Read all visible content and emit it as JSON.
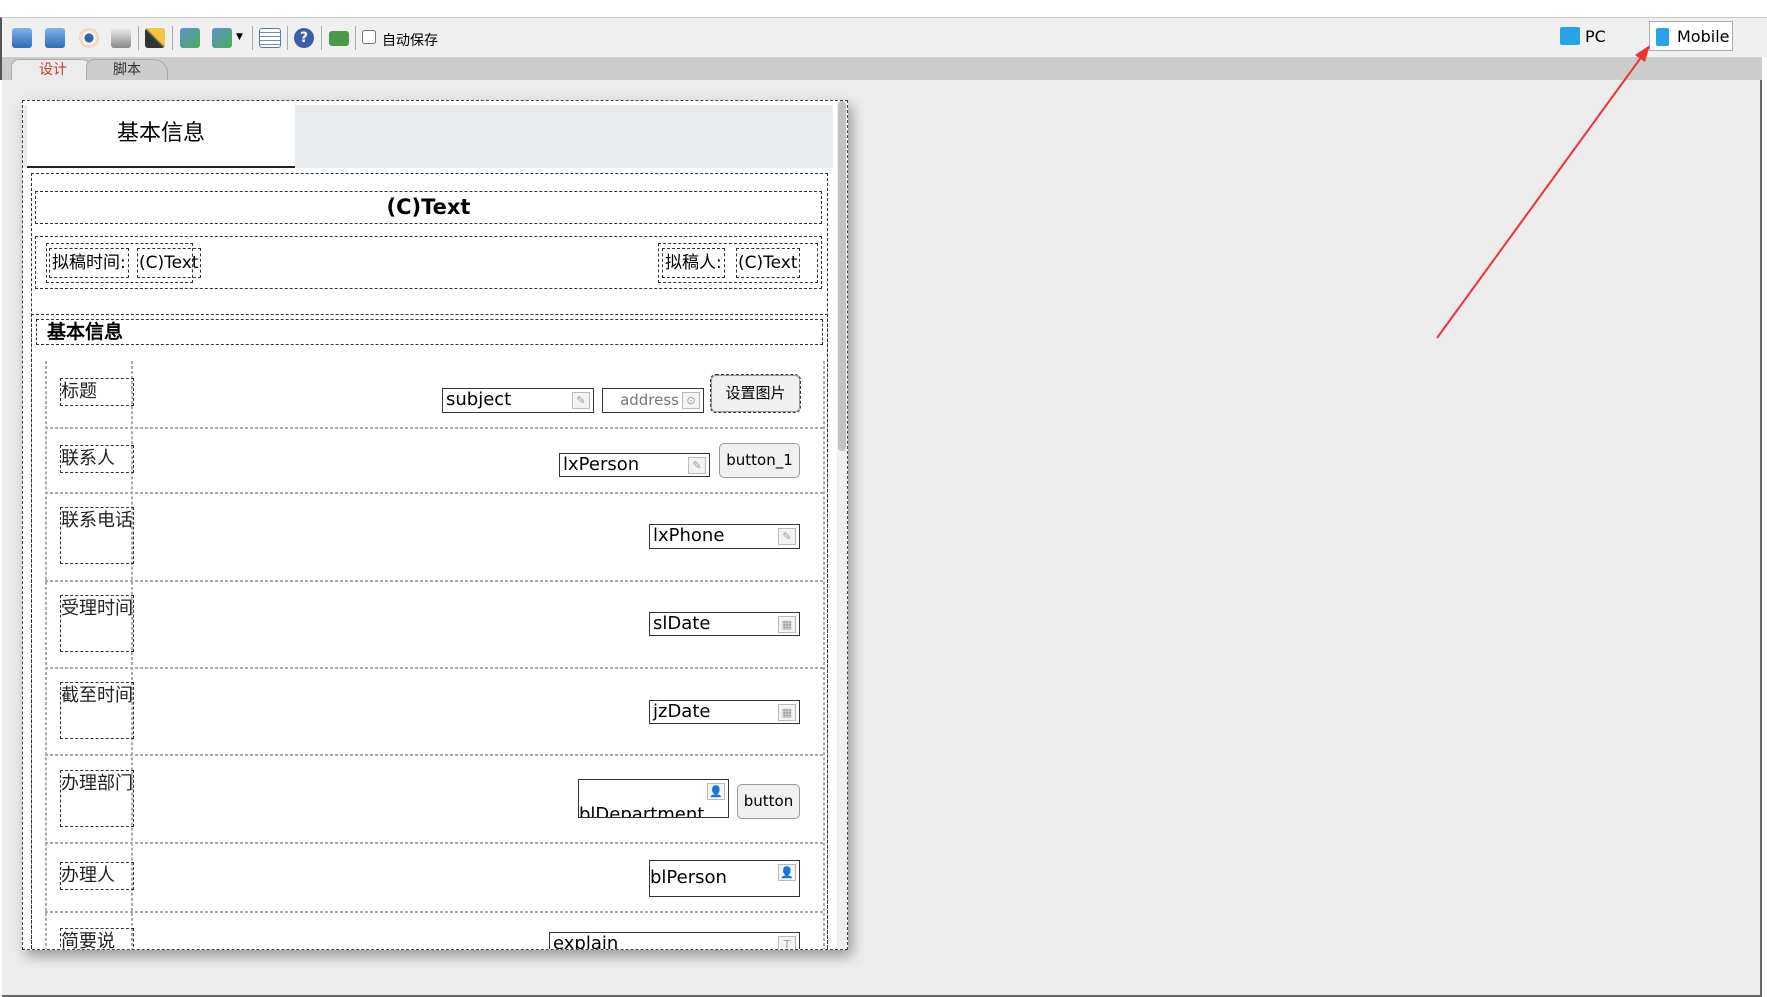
{
  "toolbar": {
    "icons": [
      "save-icon",
      "save-as-icon",
      "preview-icon",
      "print-icon",
      "wand-icon",
      "import-icon",
      "export-icon",
      "list-icon",
      "help-icon",
      "layers-icon"
    ],
    "autosave_label": "自动保存",
    "autosave_checked": false,
    "pc_label": "PC",
    "mobile_label": "Mobile"
  },
  "editor_tabs": [
    {
      "label": "设计",
      "active": true
    },
    {
      "label": "脚本",
      "active": false
    }
  ],
  "form": {
    "tab_label": "基本信息",
    "title_text": "(C)Text",
    "draft_time_label": "拟稿时间:",
    "draft_time_value": "(C)Text",
    "drafter_label": "拟稿人:",
    "drafter_value": "(C)Text",
    "section_title": "基本信息",
    "rows": [
      {
        "label": "标题",
        "field": "subject",
        "field2": "address",
        "button": "设置图片"
      },
      {
        "label": "联系人",
        "field": "lxPerson",
        "button": "button_1"
      },
      {
        "label": "联系电话",
        "field": "lxPhone"
      },
      {
        "label": "受理时间",
        "field": "slDate"
      },
      {
        "label": "截至时间",
        "field": "jzDate"
      },
      {
        "label": "办理部门",
        "field": "blDepartment",
        "button": "button"
      },
      {
        "label": "办理人",
        "field": "blPerson"
      },
      {
        "label": "简要说",
        "field": "explain"
      }
    ]
  },
  "colors": {
    "accent_tab": "#c0392b",
    "arrow": "#ee3333",
    "workspace": "#ececec"
  }
}
